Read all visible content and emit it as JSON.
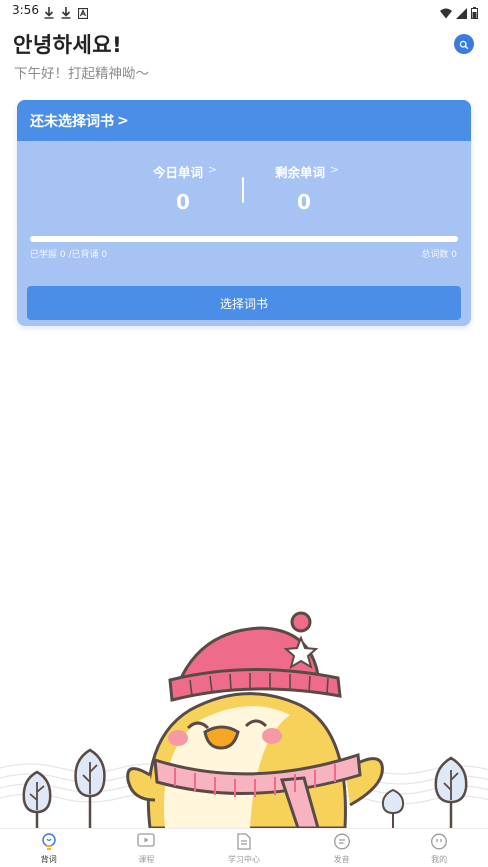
{
  "status_bar": {
    "time": "3:56",
    "left_icons": [
      "download-icon",
      "download-icon",
      "keyboard-icon"
    ],
    "right_icons": [
      "wifi-icon",
      "signal-icon",
      "battery-icon"
    ]
  },
  "header": {
    "greeting": "안녕하세요!",
    "subgreeting": "下午好！打起精神呦～",
    "search_icon": "search-icon",
    "accent_color": "#3a7be0"
  },
  "card": {
    "title": "还未选择词书",
    "title_chevron": ">",
    "stats": [
      {
        "label": "今日单词",
        "chevron": ">",
        "value": "0"
      },
      {
        "label": "剩余单词",
        "chevron": ">",
        "value": "0"
      }
    ],
    "progress": {
      "fraction": 0,
      "left_text": "已学握 0 /已背诵 0",
      "right_text": "总词数 0"
    },
    "button_label": "选择词书",
    "header_color": "#4a8ee7",
    "body_color": "#a6c3f3"
  },
  "tabbar": {
    "tabs": [
      {
        "label": "背词",
        "icon": "lightbulb-icon",
        "active": true
      },
      {
        "label": "课程",
        "icon": "video-play-icon",
        "active": false
      },
      {
        "label": "学习中心",
        "icon": "document-icon",
        "active": false
      },
      {
        "label": "发音",
        "icon": "pronunciation-icon",
        "active": false
      },
      {
        "label": "我的",
        "icon": "profile-icon",
        "active": false
      }
    ]
  }
}
